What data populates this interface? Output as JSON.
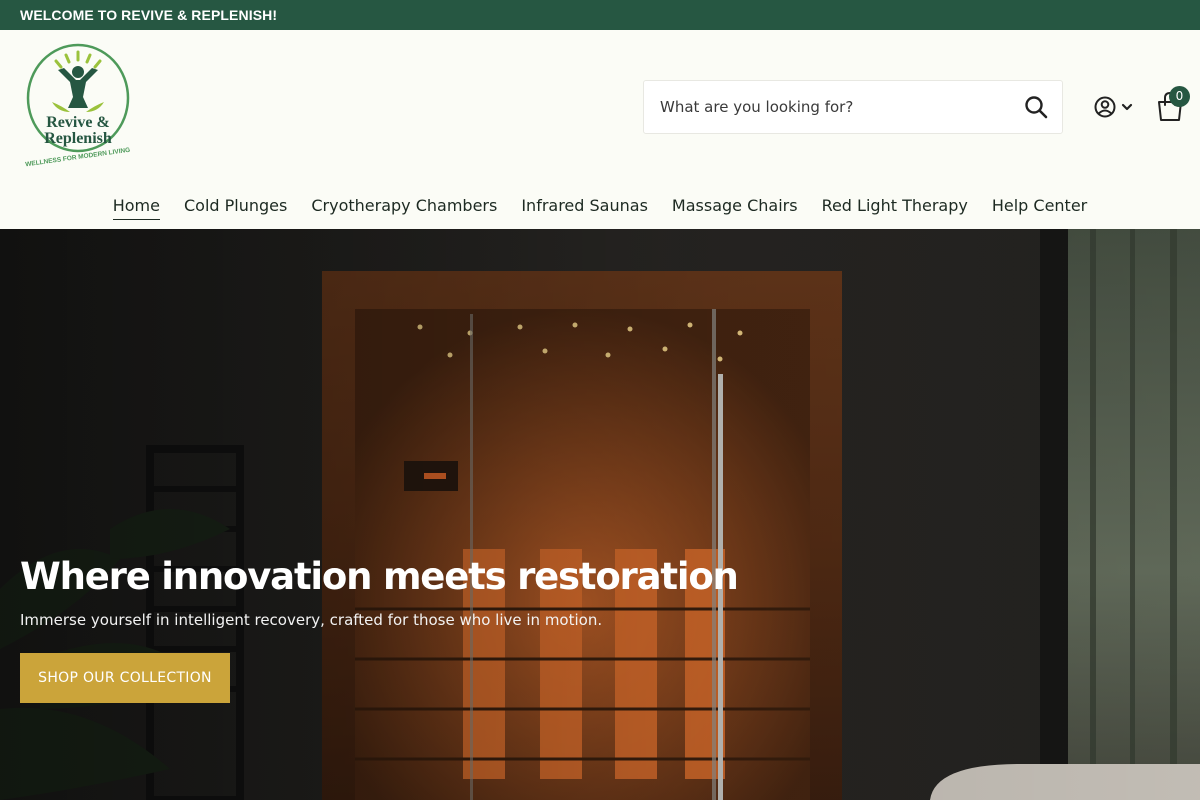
{
  "announcement": {
    "text": "WELCOME TO REVIVE & REPLENISH!"
  },
  "brand": {
    "logo_line1": "Revive &",
    "logo_line2": "Replenish",
    "tagline": "WELLNESS FOR MODERN LIVING",
    "colors": {
      "primary": "#265742",
      "accent": "#cba43a",
      "background": "#fbfcf6"
    }
  },
  "search": {
    "placeholder": "What are you looking for?",
    "icon": "search-icon"
  },
  "header_icons": {
    "account": "user-circle-icon",
    "account_chevron": "chevron-down-icon",
    "cart": "shopping-bag-icon",
    "cart_count": "0"
  },
  "nav": {
    "items": [
      {
        "label": "Home",
        "active": true
      },
      {
        "label": "Cold Plunges"
      },
      {
        "label": "Cryotherapy Chambers"
      },
      {
        "label": "Infrared Saunas"
      },
      {
        "label": "Massage Chairs"
      },
      {
        "label": "Red Light Therapy"
      },
      {
        "label": "Help Center"
      }
    ]
  },
  "hero": {
    "title": "Where innovation meets restoration",
    "subtitle": "Immerse yourself in intelligent recovery, crafted for those who live in motion.",
    "cta": "SHOP OUR COLLECTION"
  }
}
